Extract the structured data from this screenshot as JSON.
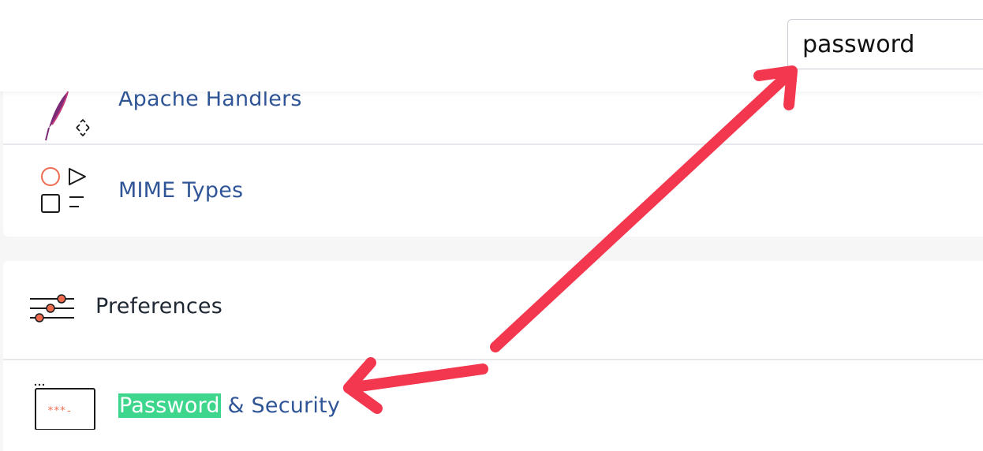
{
  "search": {
    "value": "password"
  },
  "items": {
    "apache_handlers": {
      "label": "Apache Handlers"
    },
    "mime_types": {
      "label": "MIME Types"
    },
    "preferences": {
      "label": "Preferences"
    },
    "password_security": {
      "highlight": "Password",
      "rest": " & Security"
    }
  },
  "colors": {
    "link": "#2f5597",
    "dark_text": "#1f2733",
    "highlight": "#3dd68c",
    "accent_orange": "#ee6c4d",
    "annotation_red": "#f2374e"
  }
}
